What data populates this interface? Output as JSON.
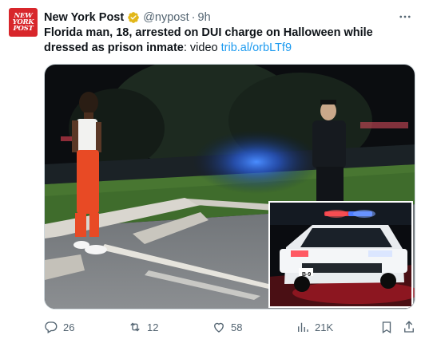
{
  "tweet": {
    "avatar": {
      "logo_lines": [
        "NEW",
        "YORK",
        "POST"
      ]
    },
    "author_name": "New York Post",
    "handle": "@nypost",
    "separator": "·",
    "time": "9h",
    "more_icon": "more-horizontal-icon",
    "text_bold": "Florida man, 18, arrested on DUI charge on Halloween while dressed as prison inmate",
    "text_plain": ": video ",
    "link": "trib.al/orbLTf9",
    "colors": {
      "accent": "#1d9bf0",
      "muted": "#536471",
      "brand": "#d8262b",
      "verified": "#e2b719"
    }
  },
  "media": {
    "description_icon": "video-thumbnail",
    "inset_plate": "B-9"
  },
  "actions": {
    "reply_count": "26",
    "retweet_count": "12",
    "like_count": "58",
    "views_count": "21K"
  }
}
